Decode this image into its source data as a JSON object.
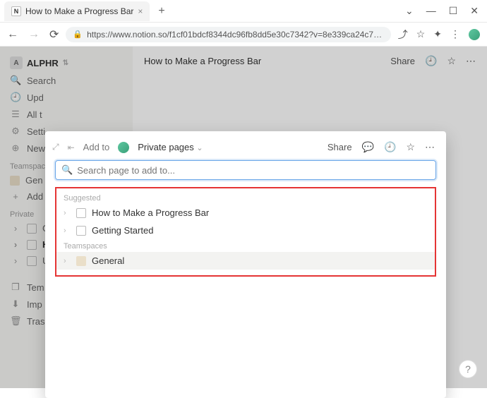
{
  "window": {
    "tab_title": "How to Make a Progress Bar",
    "url": "https://www.notion.so/f1cf01bdcf8344dc96fb8dd5e30c7342?v=8e339ca24c7…"
  },
  "workspace": {
    "name": "ALPHR",
    "initial": "A"
  },
  "sidebar": {
    "search": "Search",
    "updates": "Upd",
    "alltasks": "All t",
    "settings": "Setti",
    "newpage": "New",
    "teamspaces_label": "Teamspaces",
    "team_general": "Gen",
    "add": "Add",
    "private_label": "Private",
    "priv_ge": "Ge",
    "priv_ho": "Ho",
    "priv_un": "Un",
    "templates": "Tem",
    "import": "Imp",
    "trash": "Tras"
  },
  "page": {
    "title": "How to Make a Progress Bar",
    "share": "Share"
  },
  "modal": {
    "addto": "Add to",
    "target": "Private pages",
    "share": "Share",
    "search_placeholder": "Search page to add to...",
    "suggested_label": "Suggested",
    "suggested": [
      {
        "label": "How to Make a Progress Bar"
      },
      {
        "label": "Getting Started"
      }
    ],
    "teamspaces_label": "Teamspaces",
    "teamspaces": [
      {
        "label": "General"
      }
    ]
  },
  "help": "?"
}
